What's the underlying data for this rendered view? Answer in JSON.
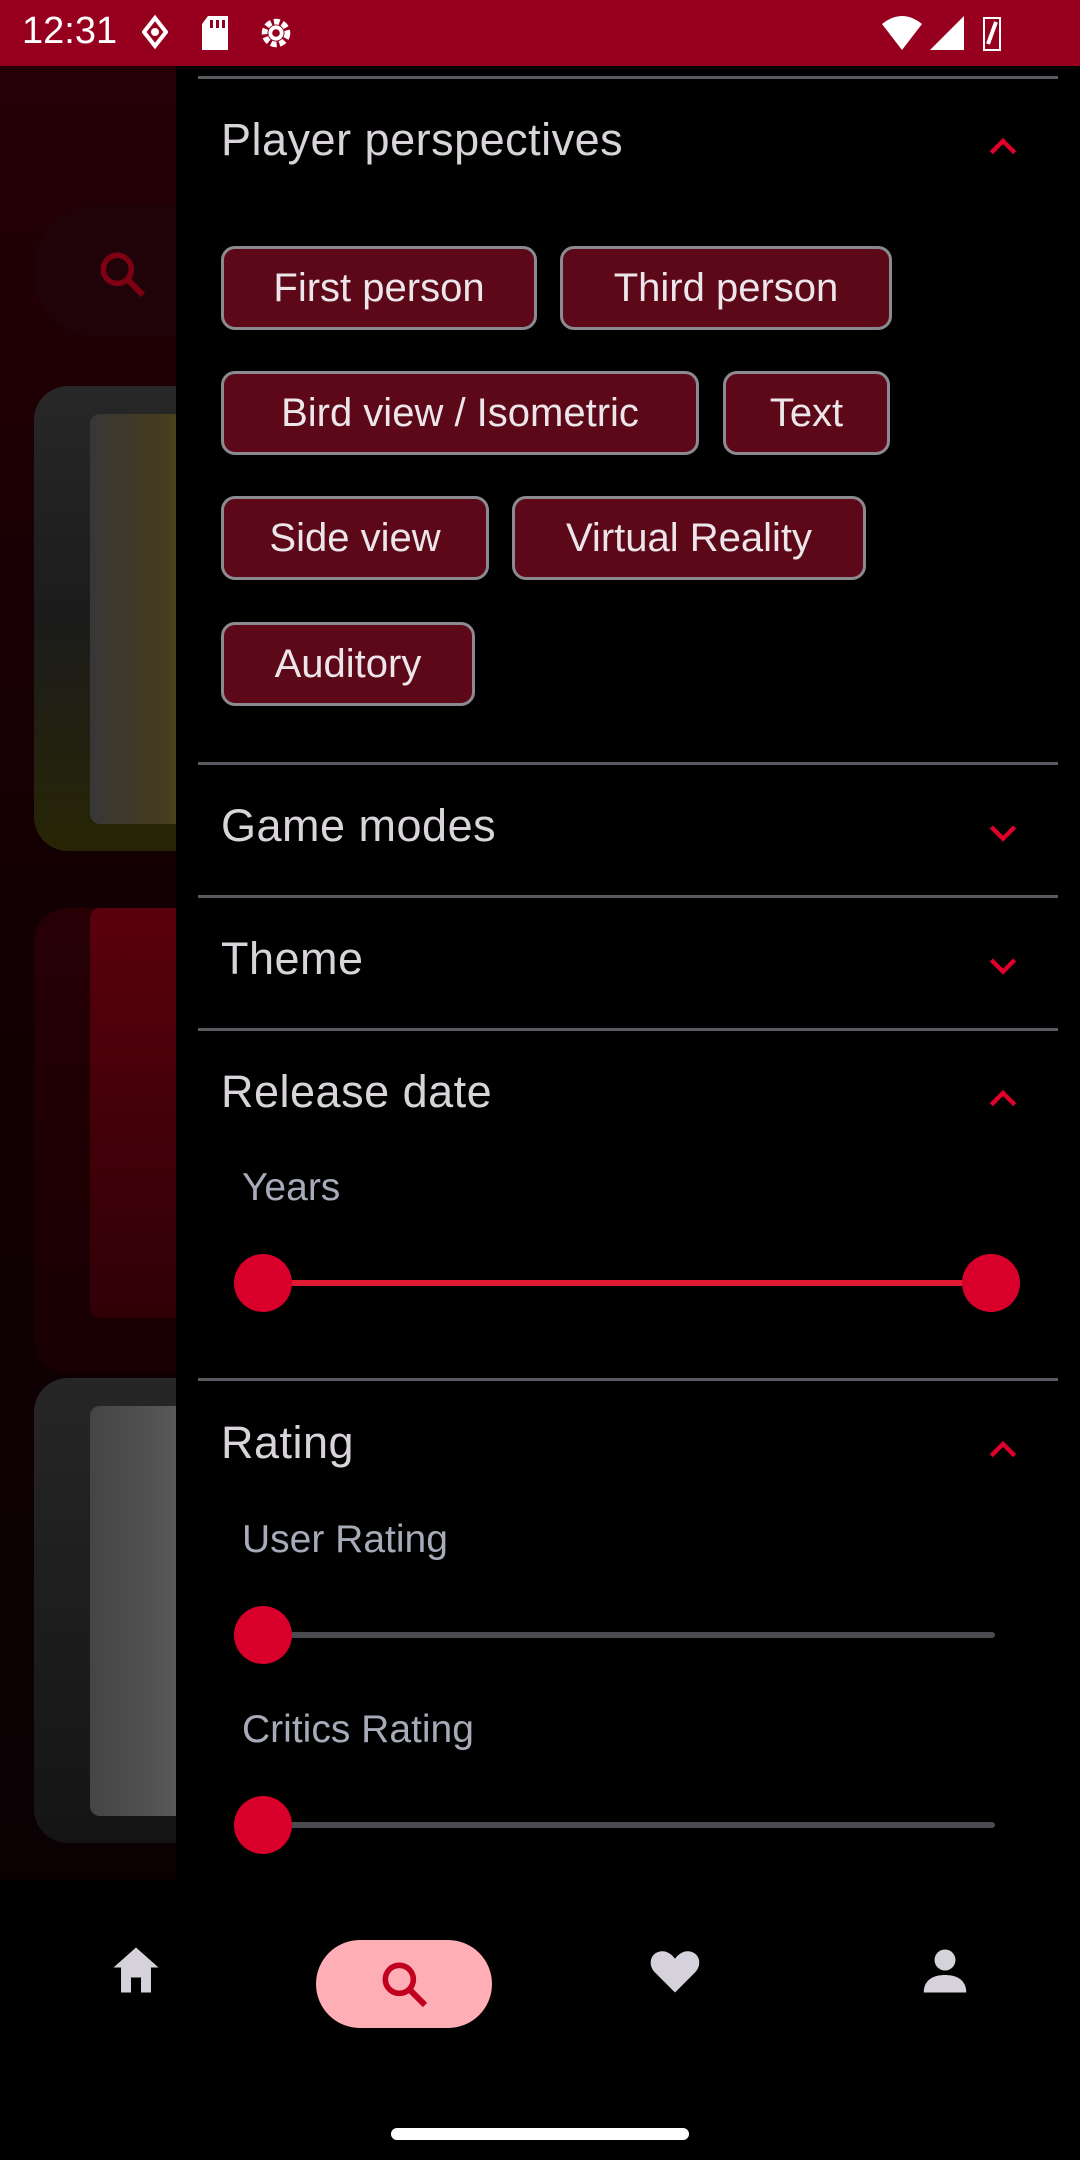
{
  "status_bar": {
    "time": "12:31"
  },
  "drawer": {
    "sections": {
      "player_perspectives": {
        "title": "Player perspectives",
        "chips": [
          "First person",
          "Third person",
          "Bird view / Isometric",
          "Text",
          "Side view",
          "Virtual Reality",
          "Auditory"
        ]
      },
      "game_modes": {
        "title": "Game modes"
      },
      "theme": {
        "title": "Theme"
      },
      "release_date": {
        "title": "Release date",
        "years_label": "Years",
        "years_range": [
          0,
          1
        ]
      },
      "rating": {
        "title": "Rating",
        "user_rating_label": "User Rating",
        "user_rating_value": 0,
        "critics_rating_label": "Critics Rating",
        "critics_rating_value": 0
      }
    }
  },
  "bottom_nav": {
    "items": [
      "home-icon",
      "search-icon",
      "heart-icon",
      "person-icon"
    ],
    "active": "search-icon"
  },
  "colors": {
    "accent": "#d8002a",
    "status_bar": "#96001e",
    "chip_bg": "#5c0818",
    "active_pill": "#ffaeb6"
  }
}
